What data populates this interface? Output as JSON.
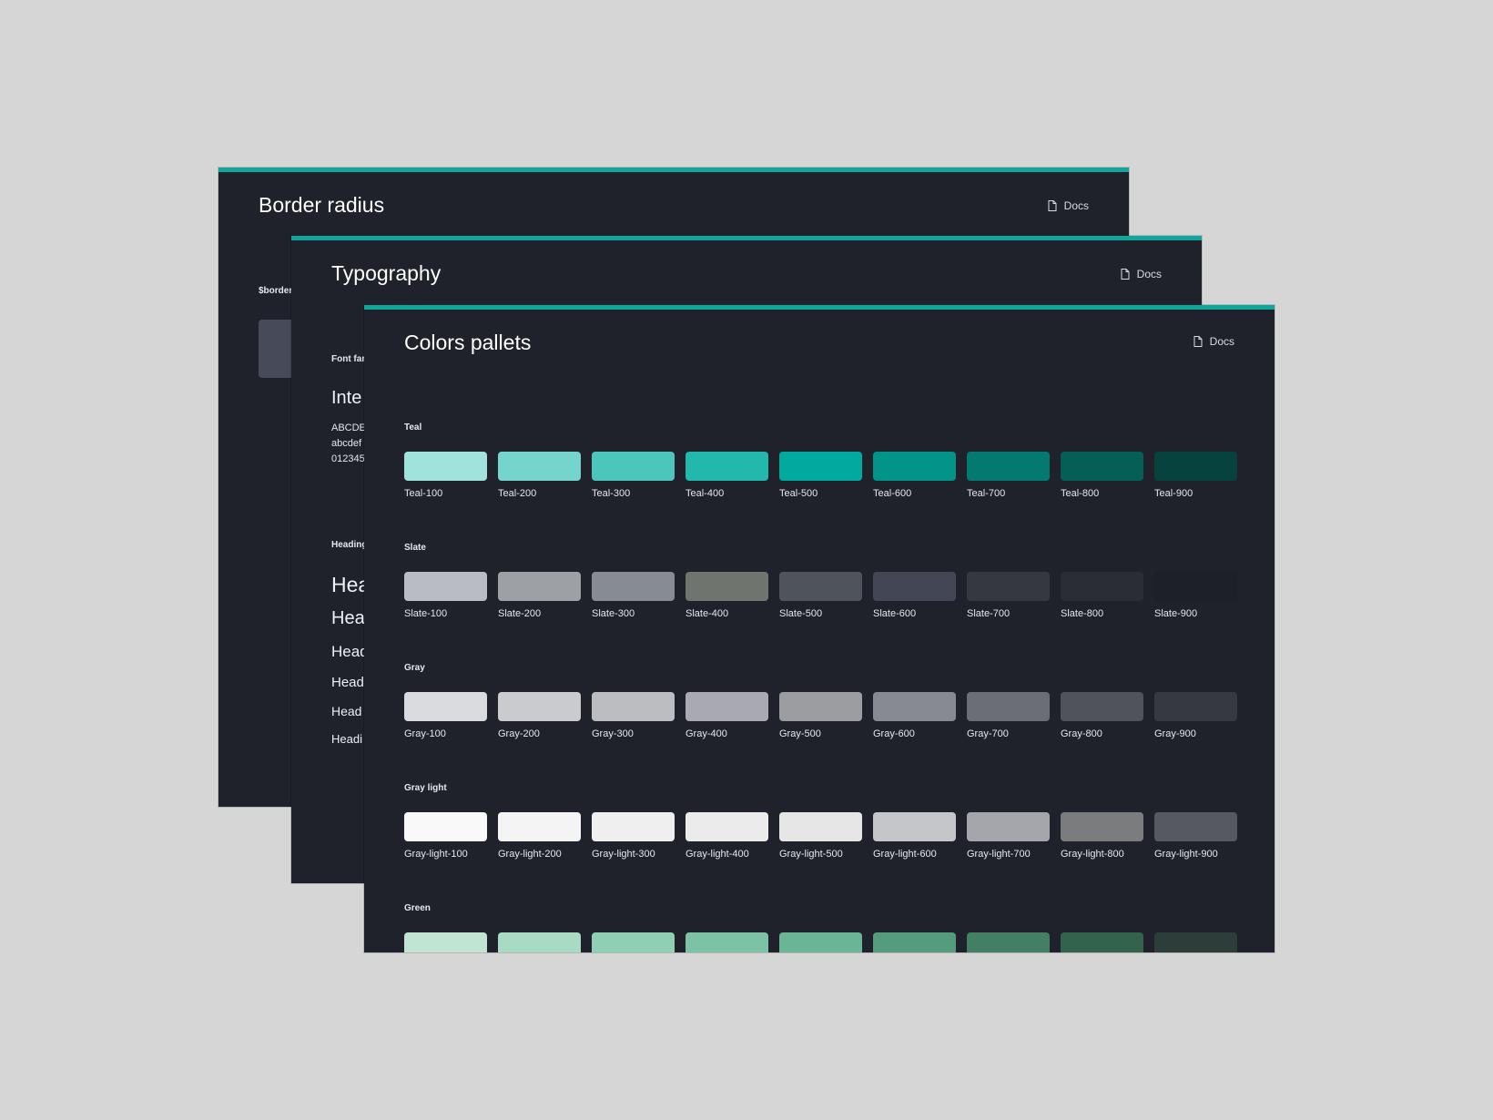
{
  "cards": {
    "border_radius": {
      "title": "Border radius",
      "docs_label": "Docs",
      "token_label": "$border"
    },
    "typography": {
      "title": "Typography",
      "docs_label": "Docs",
      "font_family_label": "Font far",
      "font_name": "Inte",
      "alphabet_lines": [
        "ABCDE",
        "abcdef",
        "012345"
      ],
      "headings_label": "Heading",
      "heading_samples": [
        "Hea",
        "Hea",
        "Head",
        "Head",
        "Head",
        "Headi"
      ]
    },
    "colors": {
      "title": "Colors pallets",
      "docs_label": "Docs",
      "palettes": [
        {
          "name": "Teal",
          "swatches": [
            {
              "label": "Teal-100",
              "color": "#9fe3dc"
            },
            {
              "label": "Teal-200",
              "color": "#75d4cc"
            },
            {
              "label": "Teal-300",
              "color": "#4cc6bb"
            },
            {
              "label": "Teal-400",
              "color": "#22b8ab"
            },
            {
              "label": "Teal-500",
              "color": "#00aa9d"
            },
            {
              "label": "Teal-600",
              "color": "#029488"
            },
            {
              "label": "Teal-700",
              "color": "#037a70"
            },
            {
              "label": "Teal-800",
              "color": "#055f57"
            },
            {
              "label": "Teal-900",
              "color": "#07433e"
            }
          ]
        },
        {
          "name": "Slate",
          "swatches": [
            {
              "label": "Slate-100",
              "color": "#b9bcc5"
            },
            {
              "label": "Slate-200",
              "color": "#9da1a6"
            },
            {
              "label": "Slate-300",
              "color": "#878b93"
            },
            {
              "label": "Slate-400",
              "color": "#6f746f"
            },
            {
              "label": "Slate-500",
              "color": "#4e545a"
            },
            {
              "label": "Slate-600",
              "color": "#434755"
            },
            {
              "label": "Slate-700",
              "color": "#353840"
            },
            {
              "label": "Slate-800",
              "color": "#2a2d35"
            },
            {
              "label": "Slate-900",
              "color": "#1d2027"
            }
          ]
        },
        {
          "name": "Gray",
          "swatches": [
            {
              "label": "Gray-100",
              "color": "#dadbdf"
            },
            {
              "label": "Gray-200",
              "color": "#cacbcf"
            },
            {
              "label": "Gray-300",
              "color": "#bcbdc1"
            },
            {
              "label": "Gray-400",
              "color": "#a9aab1"
            },
            {
              "label": "Gray-500",
              "color": "#9c9da1"
            },
            {
              "label": "Gray-600",
              "color": "#878a92"
            },
            {
              "label": "Gray-700",
              "color": "#6b6e76"
            },
            {
              "label": "Gray-800",
              "color": "#50535c"
            },
            {
              "label": "Gray-900",
              "color": "#363940"
            }
          ]
        },
        {
          "name": "Gray light",
          "swatches": [
            {
              "label": "Gray-light-100",
              "color": "#f9f9f9"
            },
            {
              "label": "Gray-light-200",
              "color": "#f4f4f4"
            },
            {
              "label": "Gray-light-300",
              "color": "#efefef"
            },
            {
              "label": "Gray-light-400",
              "color": "#ebebeb"
            },
            {
              "label": "Gray-light-500",
              "color": "#e6e6e6"
            },
            {
              "label": "Gray-light-600",
              "color": "#c5c6c9"
            },
            {
              "label": "Gray-light-700",
              "color": "#a4a6ab"
            },
            {
              "label": "Gray-light-800",
              "color": "#7b7c7e"
            },
            {
              "label": "Gray-light-900",
              "color": "#565961"
            }
          ]
        },
        {
          "name": "Green",
          "swatches": [
            {
              "label": "",
              "color": "#c1e4d3"
            },
            {
              "label": "",
              "color": "#a8dac4"
            },
            {
              "label": "",
              "color": "#8fcfb3"
            },
            {
              "label": "",
              "color": "#7cc2a4"
            },
            {
              "label": "",
              "color": "#69b595"
            },
            {
              "label": "",
              "color": "#549c7d"
            },
            {
              "label": "",
              "color": "#427f64"
            },
            {
              "label": "",
              "color": "#33634d"
            },
            {
              "label": "",
              "color": "#2d3e3a"
            }
          ]
        }
      ]
    }
  },
  "icons": {
    "docs": "document-icon"
  },
  "accent_color": "#10a69c",
  "card_background": "#1f222b",
  "page_background": "#d6d6d6"
}
